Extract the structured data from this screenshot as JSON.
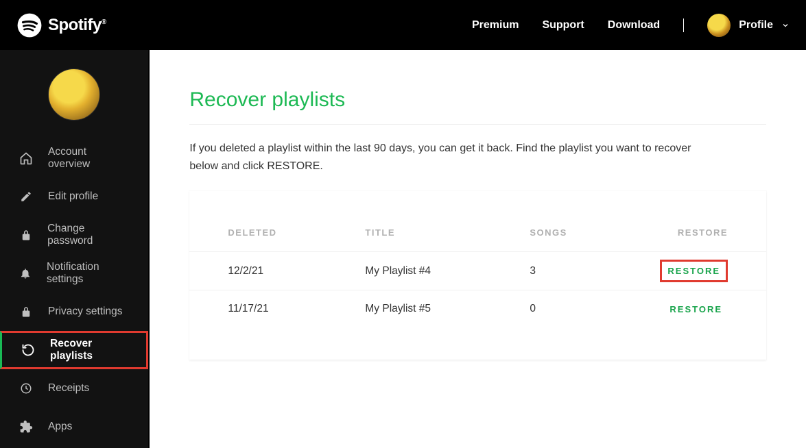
{
  "header": {
    "brand": "Spotify",
    "nav": {
      "premium": "Premium",
      "support": "Support",
      "download": "Download",
      "profile": "Profile"
    }
  },
  "sidebar": {
    "items": [
      {
        "icon": "home",
        "label": "Account overview"
      },
      {
        "icon": "pencil",
        "label": "Edit profile"
      },
      {
        "icon": "lock",
        "label": "Change password"
      },
      {
        "icon": "bell",
        "label": "Notification settings"
      },
      {
        "icon": "lock",
        "label": "Privacy settings"
      },
      {
        "icon": "refresh",
        "label": "Recover playlists"
      },
      {
        "icon": "clock",
        "label": "Receipts"
      },
      {
        "icon": "puzzle",
        "label": "Apps"
      }
    ],
    "active_index": 5
  },
  "main": {
    "title": "Recover playlists",
    "description": "If you deleted a playlist within the last 90 days, you can get it back. Find the playlist you want to recover below and click RESTORE.",
    "columns": {
      "deleted": "DELETED",
      "title": "TITLE",
      "songs": "SONGS",
      "restore": "RESTORE"
    },
    "restore_label": "RESTORE",
    "rows": [
      {
        "deleted": "12/2/21",
        "title": "My Playlist #4",
        "songs": "3",
        "highlight": true
      },
      {
        "deleted": "11/17/21",
        "title": "My Playlist #5",
        "songs": "0",
        "highlight": false
      }
    ]
  }
}
